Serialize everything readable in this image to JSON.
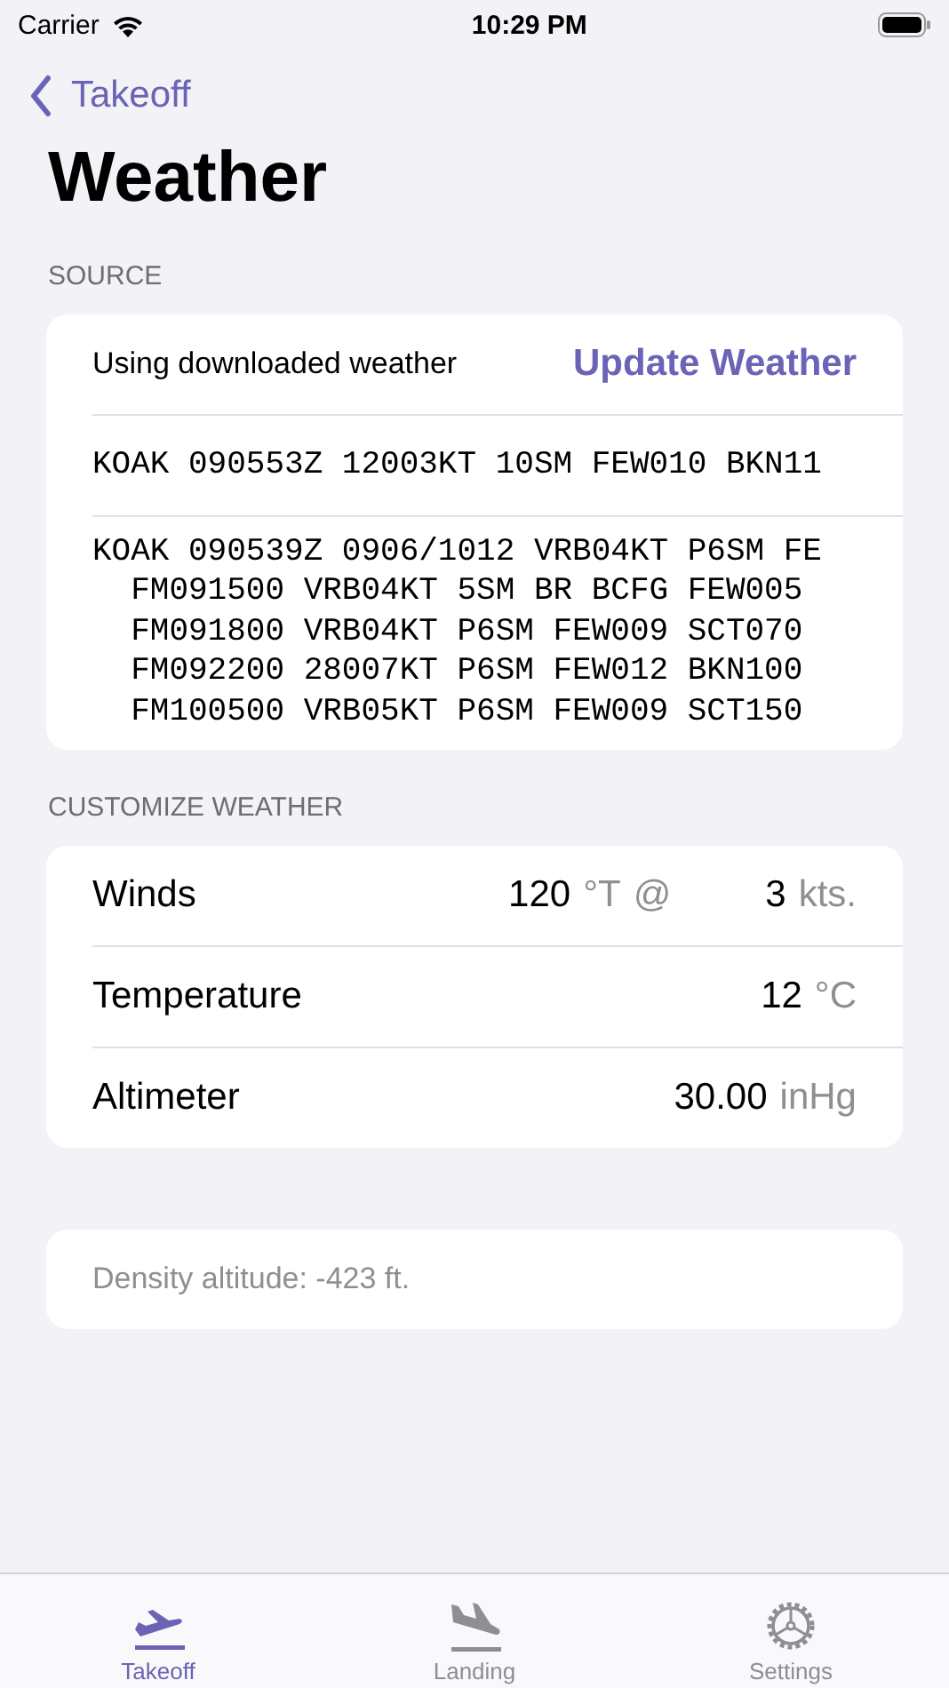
{
  "status_bar": {
    "carrier": "Carrier",
    "time": "10:29 PM"
  },
  "nav": {
    "back": "Takeoff",
    "title": "Weather"
  },
  "source": {
    "header": "SOURCE",
    "status": "Using downloaded weather",
    "action": "Update Weather",
    "metar": "KOAK 090553Z 12003KT 10SM FEW010 BKN11",
    "taf": [
      "KOAK 090539Z 0906/1012 VRB04KT P6SM FE",
      "  FM091500 VRB04KT 5SM BR BCFG FEW005",
      "  FM091800 VRB04KT P6SM FEW009 SCT070",
      "  FM092200 28007KT P6SM FEW012 BKN100",
      "  FM100500 VRB05KT P6SM FEW009 SCT150"
    ]
  },
  "customize": {
    "header": "CUSTOMIZE WEATHER",
    "rows": [
      {
        "label": "Winds",
        "parts": [
          {
            "text": "120",
            "muted": false
          },
          {
            "text": "°T",
            "muted": true
          },
          {
            "text": "@",
            "muted": true
          },
          {
            "text": "3",
            "muted": false
          },
          {
            "text": "kts.",
            "muted": true
          }
        ]
      },
      {
        "label": "Temperature",
        "parts": [
          {
            "text": "12",
            "muted": false
          },
          {
            "text": "°C",
            "muted": true
          }
        ]
      },
      {
        "label": "Altimeter",
        "parts": [
          {
            "text": "30.00",
            "muted": false
          },
          {
            "text": "inHg",
            "muted": true
          }
        ]
      }
    ]
  },
  "density": "Density altitude: -423 ft.",
  "tabs": [
    {
      "label": "Takeoff",
      "selected": true
    },
    {
      "label": "Landing",
      "selected": false
    },
    {
      "label": "Settings",
      "selected": false
    }
  ]
}
